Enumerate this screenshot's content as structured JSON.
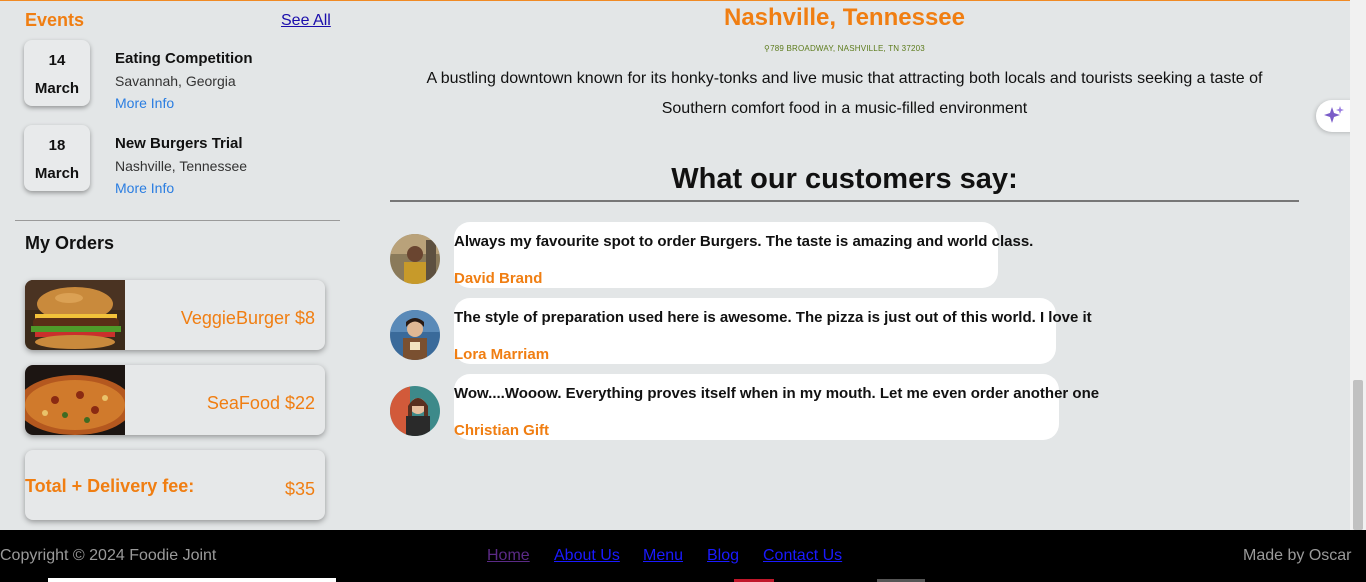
{
  "colors": {
    "accent": "#f07e12",
    "page_bg": "#e3e6e7",
    "footer_bg": "#000000",
    "link_blue": "#2a7de1"
  },
  "sidebar": {
    "events_title": "Events",
    "see_all": "See All",
    "events": [
      {
        "day": "14",
        "month": "March",
        "name": "Eating Competition",
        "place": "Savannah, Georgia",
        "more": "More Info"
      },
      {
        "day": "18",
        "month": "March",
        "name": "New Burgers Trial",
        "place": "Nashville, Tennessee",
        "more": "More Info"
      }
    ],
    "orders_title": "My Orders",
    "orders": [
      {
        "label": "VeggieBurger $8",
        "image": "burger"
      },
      {
        "label": "SeaFood $22",
        "image": "pizza"
      }
    ],
    "total_label": "Total + Delivery fee:",
    "total_value": "$35"
  },
  "location": {
    "title": "Nashville, Tennessee",
    "address_icon": "map-pin-icon",
    "address": "789 BROADWAY, NASHVILLE, TN 37203",
    "description": "A bustling downtown known for its honky-tonks and live music that attracting both locals and tourists seeking a taste of Southern comfort food in a music-filled environment"
  },
  "testimonials": {
    "title": "What our customers say:",
    "items": [
      {
        "quote": "Always my favourite spot to order Burgers. The taste is amazing and world class.",
        "author": "David Brand"
      },
      {
        "quote": "The style of preparation used here is awesome. The pizza is just out of this world. I love it",
        "author": "Lora Marriam"
      },
      {
        "quote": "Wow....Wooow. Everything proves itself when in my mouth. Let me even order another one",
        "author": "Christian Gift"
      }
    ]
  },
  "floating": {
    "icon": "sparkle-icon"
  },
  "footer": {
    "copyright": "Copyright © 2024 Foodie Joint",
    "nav": [
      "Home",
      "About Us",
      "Menu",
      "Blog",
      "Contact Us"
    ],
    "made_by": "Made by Oscar"
  }
}
